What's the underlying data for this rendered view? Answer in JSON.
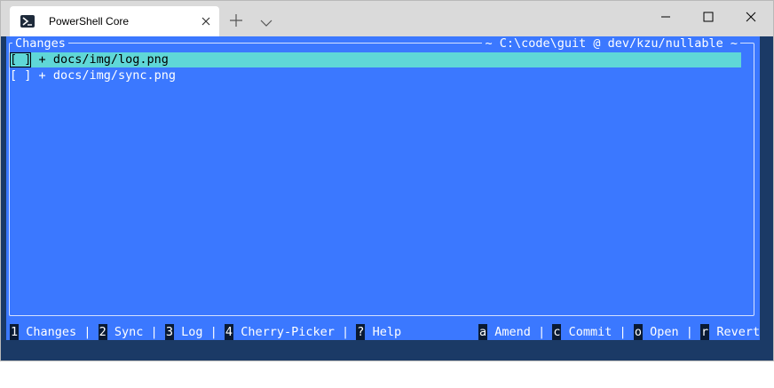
{
  "window": {
    "tab_title": "PowerShell Core"
  },
  "panel": {
    "title": "Changes",
    "path_prefix": "~",
    "path": "C:\\code\\guit @ dev/kzu/nullable",
    "path_suffix": "~"
  },
  "changes": [
    {
      "checkbox": "[ ]",
      "status": "+",
      "file": "docs/img/log.png",
      "selected": true
    },
    {
      "checkbox": "[ ]",
      "status": "+",
      "file": "docs/img/sync.png",
      "selected": false
    }
  ],
  "statusbar": {
    "left": [
      {
        "key": "1",
        "label": "Changes"
      },
      {
        "key": "2",
        "label": "Sync"
      },
      {
        "key": "3",
        "label": "Log"
      },
      {
        "key": "4",
        "label": "Cherry-Picker"
      },
      {
        "key": "?",
        "label": "Help"
      }
    ],
    "right": [
      {
        "key": "a",
        "label": "Amend"
      },
      {
        "key": "c",
        "label": "Commit"
      },
      {
        "key": "o",
        "label": "Open"
      },
      {
        "key": "r",
        "label": "Revert"
      }
    ],
    "separator": "|"
  },
  "colors": {
    "terminal_bg": "#3b78ff",
    "selection_bg": "#5fd7d7",
    "outer_bg": "#1b3a66",
    "key_bg": "#0a1a33"
  },
  "icons": {
    "tab": "powershell-icon",
    "close": "close-icon",
    "new_tab": "plus-icon",
    "dropdown": "chevron-down-icon",
    "minimize": "minimize-icon",
    "maximize": "maximize-icon",
    "window_close": "close-icon"
  }
}
